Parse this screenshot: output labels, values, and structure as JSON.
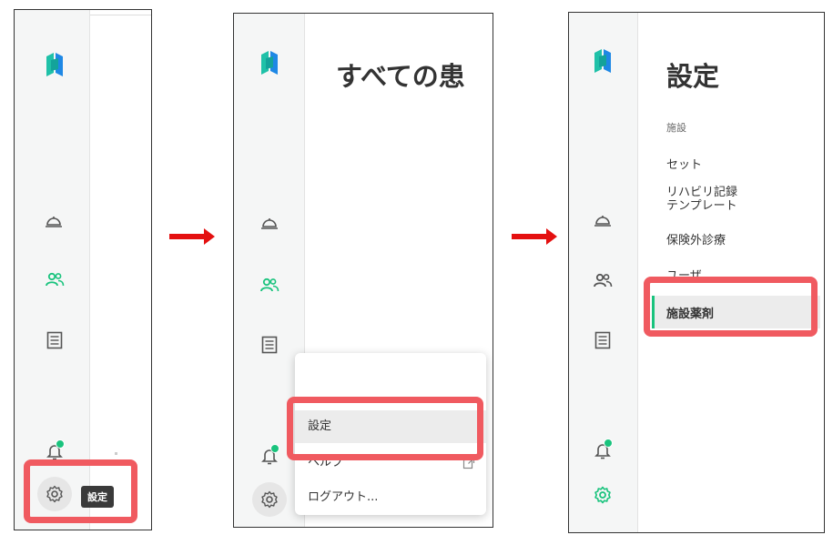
{
  "panel1": {
    "tooltip_label": "設定",
    "nav_icons": [
      "service-bell-icon",
      "patients-icon",
      "records-icon",
      "bell-icon",
      "gear-icon"
    ]
  },
  "panel2": {
    "page_title": "すべての患",
    "menu": {
      "settings_label": "設定",
      "help_label": "ヘルプ",
      "logout_label": "ログアウト..."
    }
  },
  "panel3": {
    "page_title": "設定",
    "section_label": "施設",
    "items": [
      "セット",
      "リハビリ記録\nテンプレート",
      "保険外診療",
      "ユーザ",
      "施設薬剤"
    ],
    "selected_item": "施設薬剤"
  },
  "colors": {
    "accent": "#19c37d",
    "highlight": "#f05a60",
    "arrow": "#e41010",
    "logo_teal": "#1fc1a8",
    "logo_blue": "#1e88e5"
  }
}
